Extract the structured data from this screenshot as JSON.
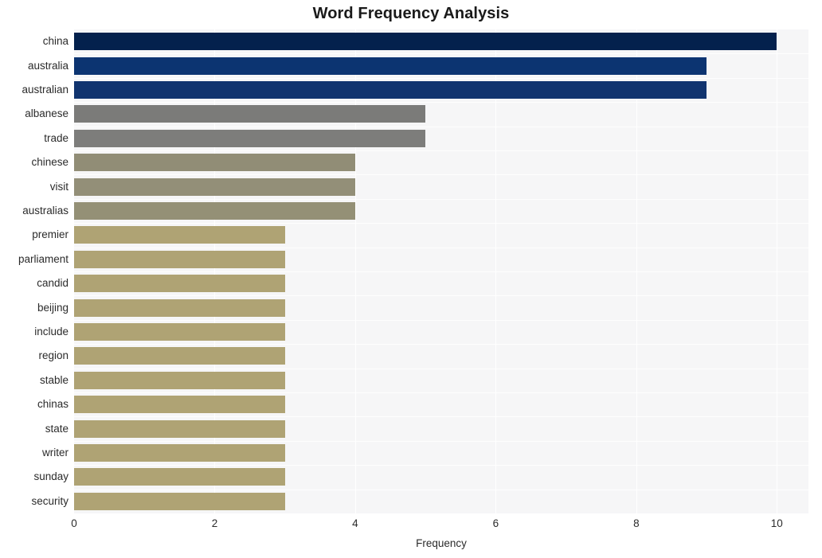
{
  "chart_data": {
    "type": "bar",
    "orientation": "horizontal",
    "title": "Word Frequency Analysis",
    "xlabel": "Frequency",
    "ylabel": "",
    "xlim": [
      0,
      10.45
    ],
    "ylim": [
      0,
      20
    ],
    "grid": true,
    "legend": null,
    "xticks": [
      "0",
      "2",
      "4",
      "6",
      "8",
      "10"
    ],
    "xtick_values": [
      0,
      2,
      4,
      6,
      8,
      10
    ],
    "categories": [
      "china",
      "australia",
      "australian",
      "albanese",
      "trade",
      "chinese",
      "visit",
      "australias",
      "premier",
      "parliament",
      "candid",
      "beijing",
      "include",
      "region",
      "stable",
      "chinas",
      "state",
      "writer",
      "sunday",
      "security"
    ],
    "values": [
      10,
      9,
      9,
      5,
      5,
      4,
      4,
      4,
      3,
      3,
      3,
      3,
      3,
      3,
      3,
      3,
      3,
      3,
      3,
      3
    ],
    "bar_colors": [
      "#04214d",
      "#0c3471",
      "#11346f",
      "#7b7b79",
      "#7d7d7b",
      "#918d76",
      "#938f78",
      "#949076",
      "#afa374",
      "#afa374",
      "#afa374",
      "#afa374",
      "#afa374",
      "#afa374",
      "#afa374",
      "#afa374",
      "#afa374",
      "#afa374",
      "#afa374",
      "#afa374"
    ]
  },
  "style": {
    "figure_background": "#ffffff",
    "plot_background": "#f6f6f7",
    "gridline_color": "#ffffff",
    "text_color": "#2b2b2b",
    "title_color": "#1a1a1a"
  }
}
